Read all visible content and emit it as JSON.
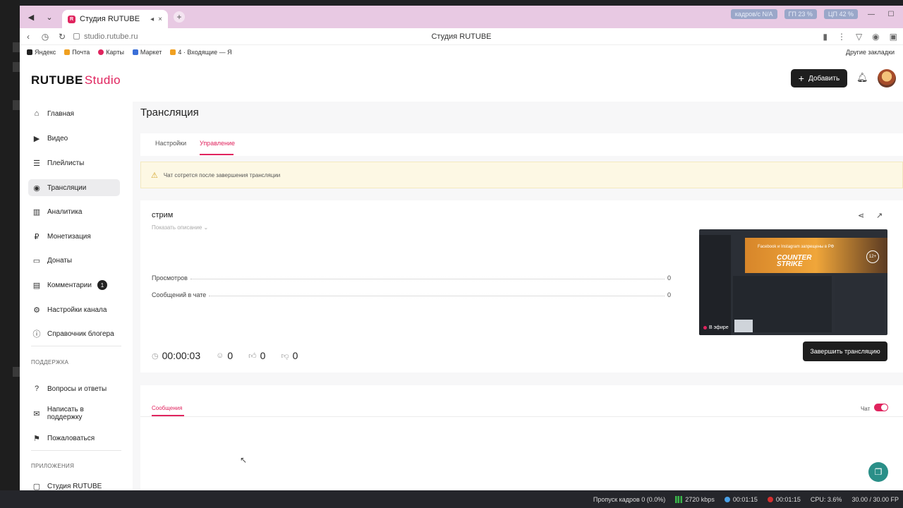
{
  "browser": {
    "tab_title": "Студия RUTUBE",
    "url": "studio.rutube.ru",
    "page_title": "Студия RUTUBE",
    "top_right": [
      "кадров/с N/A",
      "ГП 23 %",
      "ЦП 42 %"
    ],
    "bookmarks": [
      "Яндекс",
      "Почта",
      "Карты",
      "Маркет",
      "4 · Входящие — Я"
    ],
    "other_bookmarks": "Другие закладки"
  },
  "header": {
    "logo_main": "RUTUBE",
    "logo_sub": "Studio",
    "add_label": "Добавить"
  },
  "sidebar": {
    "items": [
      {
        "label": "Главная",
        "icon": "home-icon"
      },
      {
        "label": "Видео",
        "icon": "video-icon"
      },
      {
        "label": "Плейлисты",
        "icon": "playlist-icon"
      },
      {
        "label": "Трансляции",
        "icon": "broadcast-icon"
      },
      {
        "label": "Аналитика",
        "icon": "analytics-icon"
      },
      {
        "label": "Монетизация",
        "icon": "monetization-icon"
      },
      {
        "label": "Донаты",
        "icon": "donate-icon"
      },
      {
        "label": "Комментарии",
        "icon": "comment-icon"
      },
      {
        "label": "Настройки канала",
        "icon": "gear-icon"
      },
      {
        "label": "Справочник блогера",
        "icon": "info-icon"
      }
    ],
    "comments_badge": "1",
    "support_title": "ПОДДЕРЖКА",
    "support_items": [
      {
        "label": "Вопросы и ответы",
        "icon": "help-icon"
      },
      {
        "label": "Написать в поддержку",
        "icon": "mail-icon"
      },
      {
        "label": "Пожаловаться",
        "icon": "flag-icon"
      }
    ],
    "apps_title": "ПРИЛОЖЕНИЯ",
    "apps_item": "Студия RUTUBE"
  },
  "main": {
    "title": "Трансляция",
    "tabs": [
      "Настройки",
      "Управление"
    ],
    "warning": "Чат сотрется после завершения трансляции",
    "stream_name": "стрим",
    "show_description": "Показать описание",
    "stats": [
      {
        "label": "Просмотров",
        "value": "0"
      },
      {
        "label": "Сообщений в чате",
        "value": "0"
      }
    ],
    "preview": {
      "banner_text": "Facebook и Instagram запрещены в РФ",
      "game_title_1": "COUNTER",
      "game_title_2": "STRIKE",
      "age": "12+",
      "live_label": "В эфире"
    },
    "duration": "00:00:03",
    "viewers": "0",
    "likes": "0",
    "dislikes": "0",
    "end_button": "Завершить трансляцию",
    "messages_tab": "Сообщения",
    "chat_label": "Чат"
  },
  "statusbar": {
    "dropped": "Пропуск кадров 0 (0.0%)",
    "bitrate": "2720 kbps",
    "time1": "00:01:15",
    "time2": "00:01:15",
    "cpu": "CPU: 3.6%",
    "fps": "30.00 / 30.00 FP"
  },
  "colors": {
    "accent": "#e0245e",
    "dark_button": "#1e1e1e",
    "tab_bar": "#e8c9e3"
  }
}
